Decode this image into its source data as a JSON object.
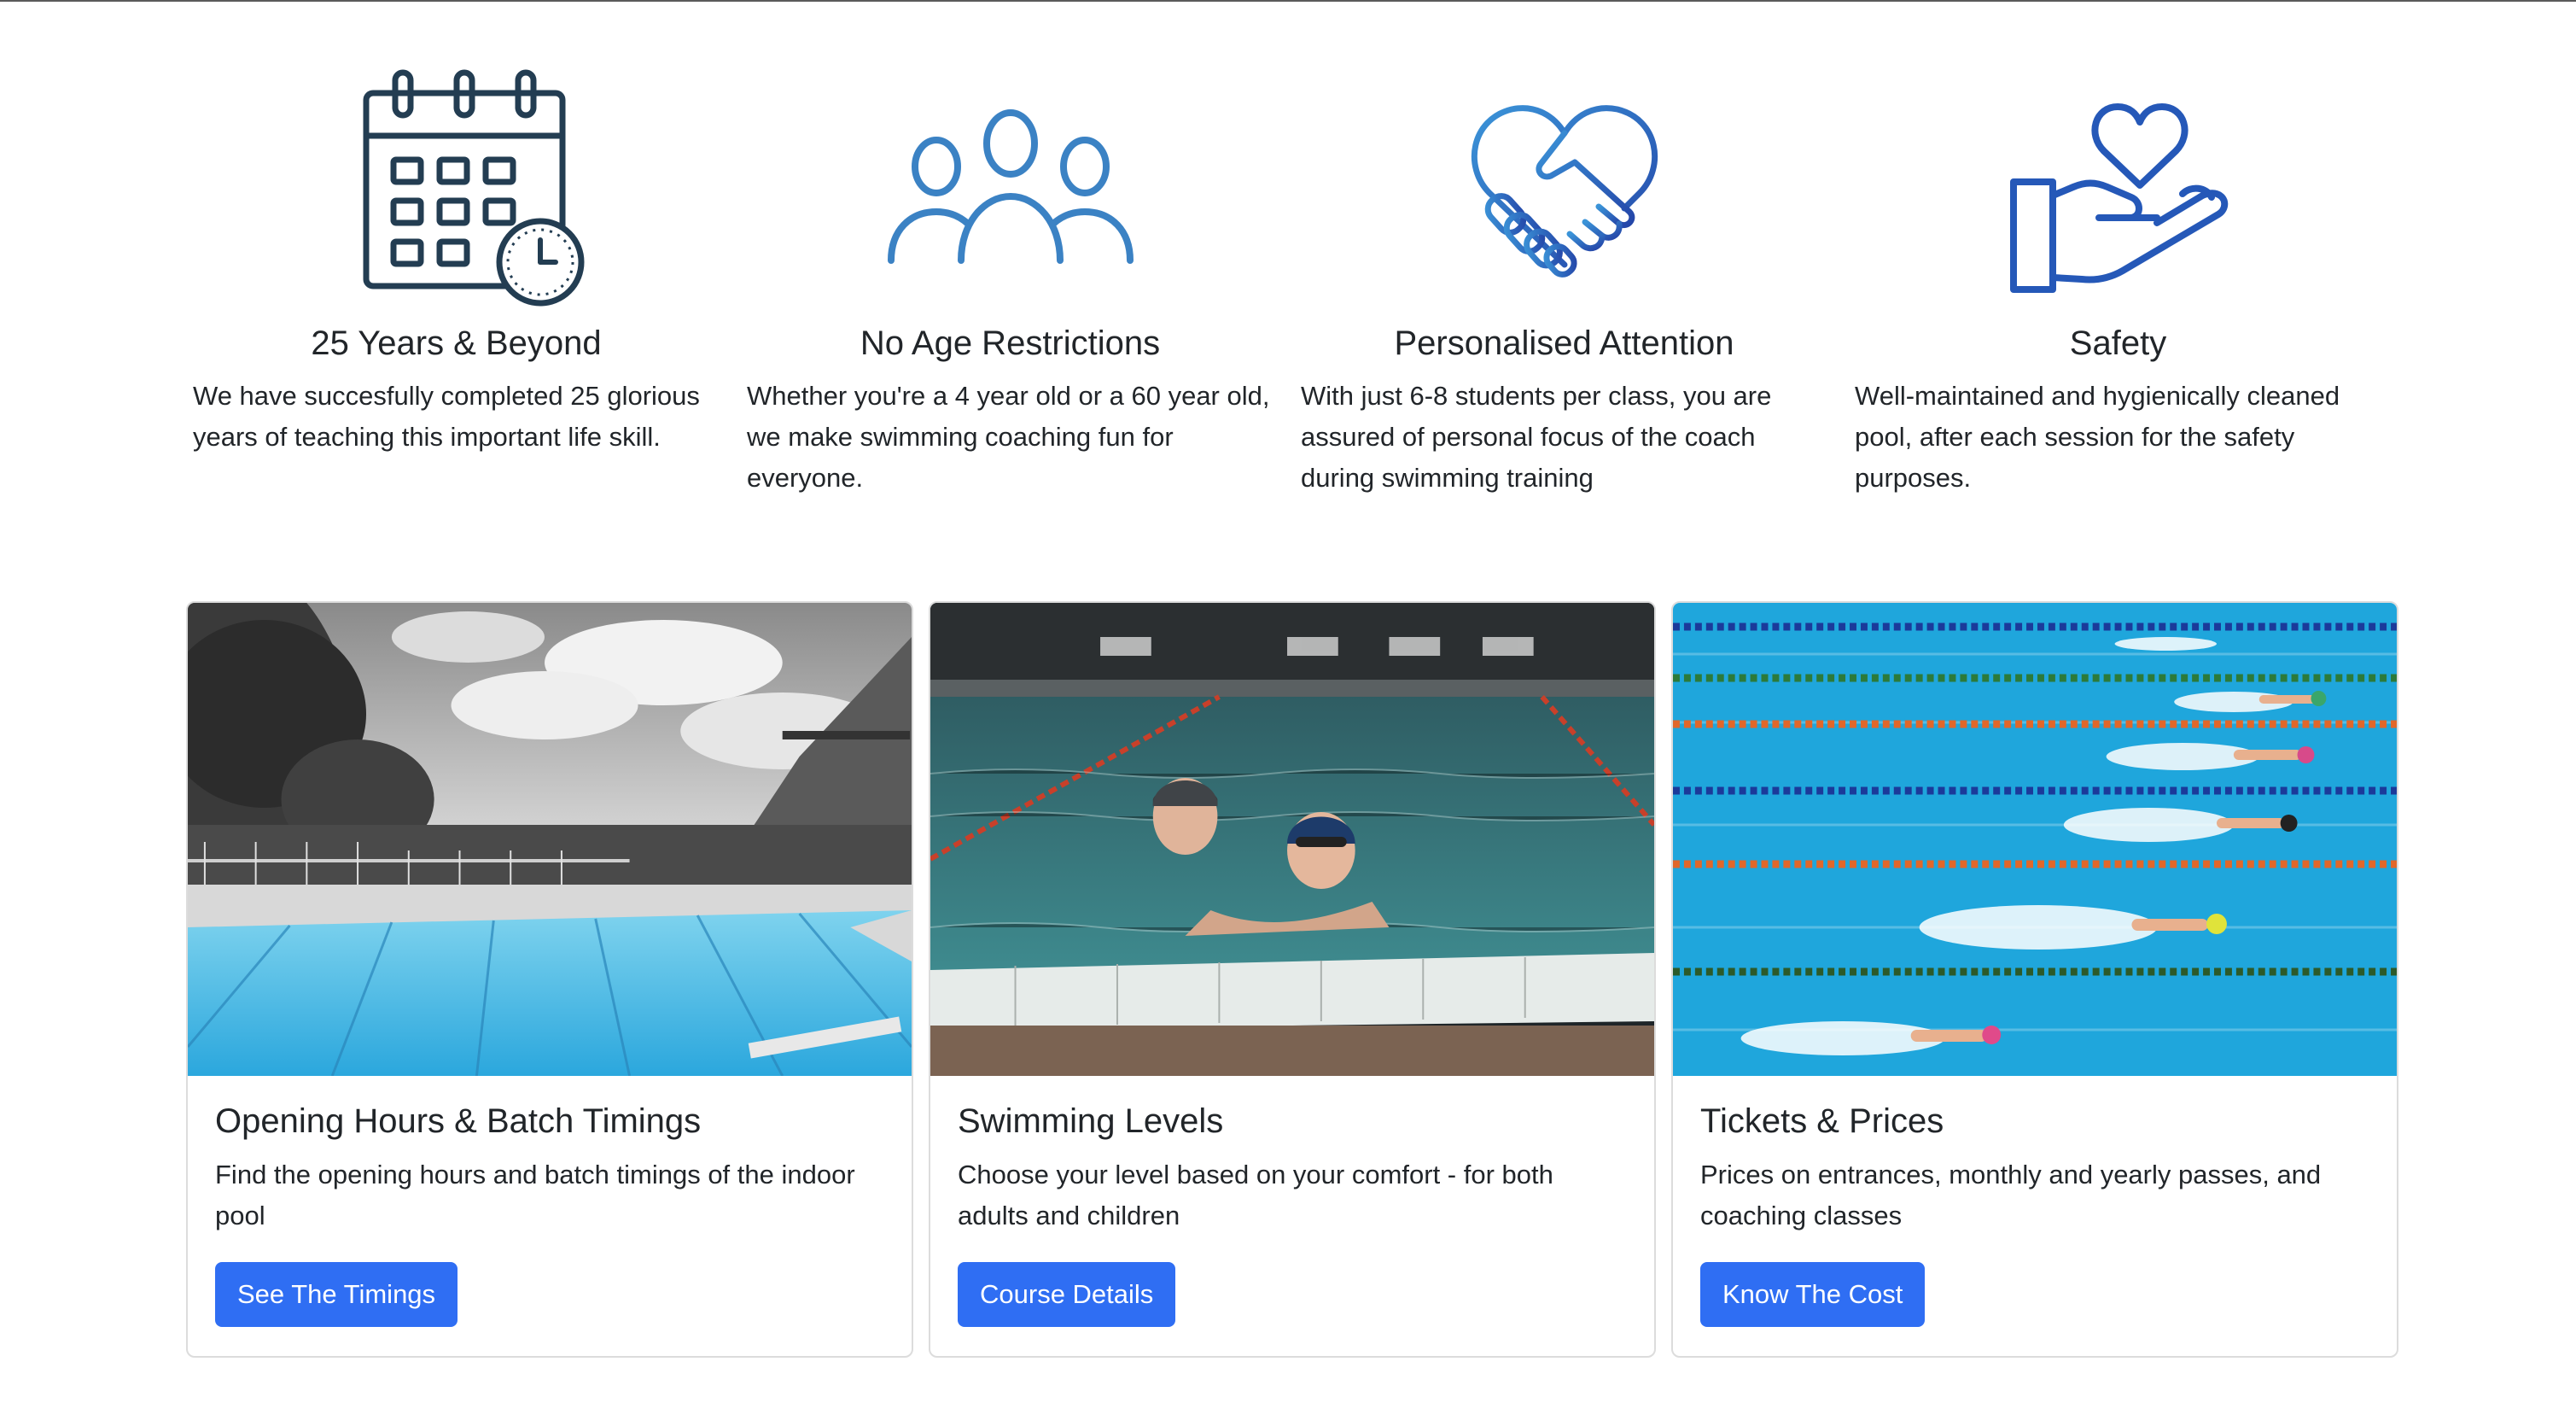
{
  "features": [
    {
      "icon": "calendar-clock-icon",
      "title": "25 Years & Beyond",
      "text": "We have succesfully completed 25 glorious years of teaching this important life skill."
    },
    {
      "icon": "group-people-icon",
      "title": "No Age Restrictions",
      "text": "Whether you're a 4 year old or a 60 year old, we make swimming coaching fun for everyone."
    },
    {
      "icon": "handshake-heart-icon",
      "title": "Personalised Attention",
      "text": "With just 6-8 students per class, you are assured of personal focus of the coach during swimming training"
    },
    {
      "icon": "hand-heart-icon",
      "title": "Safety",
      "text": "Well-maintained and hygienically cleaned pool, after each session for the safety purposes."
    }
  ],
  "cards": [
    {
      "image": "outdoor-pool-photo",
      "title": "Opening Hours & Batch Timings",
      "text": "Find the opening hours and batch timings of the indoor pool",
      "button": "See The Timings"
    },
    {
      "image": "indoor-pool-swimmers-photo",
      "title": "Swimming Levels",
      "text": "Choose your level based on your comfort - for both adults and children",
      "button": "Course Details"
    },
    {
      "image": "competition-pool-photo",
      "title": "Tickets & Prices",
      "text": "Prices on entrances, monthly and yearly passes, and coaching classes",
      "button": "Know The Cost"
    }
  ],
  "colors": {
    "button": "#2f6ef3",
    "icon_dark": "#233d52",
    "icon_blue": "#3b82c4",
    "icon_navy": "#2558b8"
  }
}
